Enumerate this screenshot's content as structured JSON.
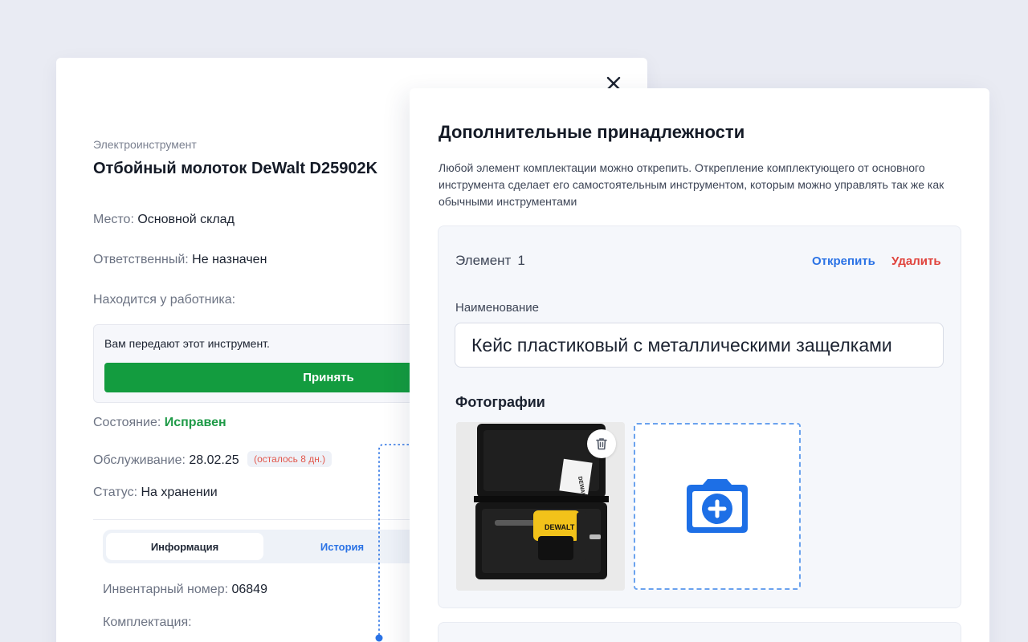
{
  "tool": {
    "category": "Электроинструмент",
    "title": "Отбойный молоток DeWalt D25902K",
    "place_label": "Место:",
    "place_value": "Основной склад",
    "responsible_label": "Ответственный:",
    "responsible_value": "Не назначен",
    "worker_label": "Находится у работника:",
    "transfer_text": "Вам передают этот инструмент.",
    "accept_label": "Принять",
    "state_label": "Состояние:",
    "state_value": "Исправен",
    "service_label": "Обслуживание:",
    "service_value": "28.02.25",
    "service_remaining": "(осталось 8 дн.)",
    "status_label": "Статус:",
    "status_value": "На хранении",
    "tabs": [
      {
        "label": "Информация",
        "active": true
      },
      {
        "label": "История",
        "active": false
      }
    ],
    "inventory_label": "Инвентарный номер:",
    "inventory_value": "06849",
    "kit_label": "Комплектация:"
  },
  "modal": {
    "title": "Дополнительные принадлежности",
    "description": "Любой элемент комплектации можно открепить. Открепление комплектующего от основного инструмента сделает его самостоятельным инструментом, которым можно управлять так же как обычными инструментами",
    "element": {
      "label": "Элемент",
      "number": "1",
      "detach_label": "Открепить",
      "delete_label": "Удалить",
      "name_label": "Наименование",
      "name_value": "Кейс пластиковый с металлическими защелками",
      "photos_label": "Фотографии",
      "photo_brand": "DEWALT"
    }
  },
  "icons": {
    "close": "close-icon",
    "trash": "trash-icon",
    "add_photo": "camera-plus-icon"
  },
  "colors": {
    "accent_blue": "#2a72e5",
    "success_green": "#139c3f",
    "danger_red": "#e0433c",
    "photo_brand_yellow": "#f2c21a"
  }
}
